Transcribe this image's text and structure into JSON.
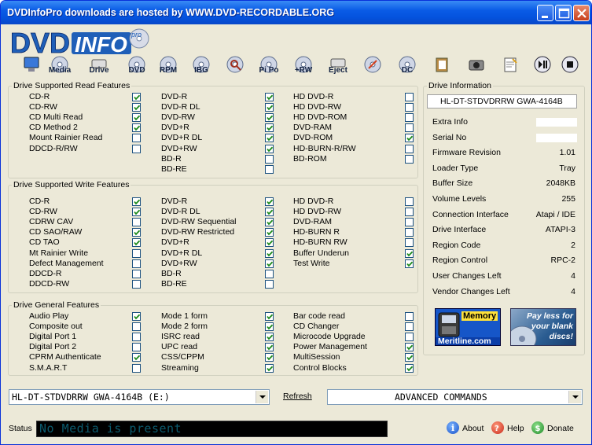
{
  "window": {
    "title": "DVDInfoPro downloads are hosted by WWW.DVD-RECORDABLE.ORG"
  },
  "logo": {
    "text_dvd": "DVD",
    "text_info": "INFO",
    "text_pro": "pro"
  },
  "toolbar": [
    {
      "name": "computer",
      "label": ""
    },
    {
      "name": "media",
      "label": "Media"
    },
    {
      "name": "drive",
      "label": "Drive"
    },
    {
      "name": "dvd",
      "label": "DVD"
    },
    {
      "name": "rpm",
      "label": "RPM"
    },
    {
      "name": "ibg",
      "label": "IBG"
    },
    {
      "name": "search",
      "label": ""
    },
    {
      "name": "pipo",
      "label": "Pi Po"
    },
    {
      "name": "plusrw",
      "label": "+RW"
    },
    {
      "name": "eject",
      "label": "Eject"
    },
    {
      "name": "burn",
      "label": ""
    },
    {
      "name": "dc",
      "label": "DC"
    },
    {
      "name": "clipboard",
      "label": ""
    },
    {
      "name": "camera",
      "label": ""
    },
    {
      "name": "notes",
      "label": ""
    },
    {
      "name": "play-pause",
      "label": ""
    },
    {
      "name": "stop",
      "label": ""
    }
  ],
  "read_features": {
    "title": "Drive Supported Read Features",
    "columns": [
      [
        {
          "label": "CD-R",
          "checked": true
        },
        {
          "label": "CD-RW",
          "checked": true
        },
        {
          "label": "CD Multi Read",
          "checked": true
        },
        {
          "label": "CD Method 2",
          "checked": true
        },
        {
          "label": "Mount Rainier Read",
          "checked": false
        },
        {
          "label": "DDCD-R/RW",
          "checked": false
        }
      ],
      [
        {
          "label": "DVD-R",
          "checked": true
        },
        {
          "label": "DVD-R DL",
          "checked": true
        },
        {
          "label": "DVD-RW",
          "checked": true
        },
        {
          "label": "DVD+R",
          "checked": true
        },
        {
          "label": "DVD+R DL",
          "checked": true
        },
        {
          "label": "DVD+RW",
          "checked": true
        },
        {
          "label": "BD-R",
          "checked": false
        },
        {
          "label": "BD-RE",
          "checked": false
        }
      ],
      [
        {
          "label": "HD DVD-R",
          "checked": false
        },
        {
          "label": "HD DVD-RW",
          "checked": false
        },
        {
          "label": "HD DVD-ROM",
          "checked": false
        },
        {
          "label": "DVD-RAM",
          "checked": false
        },
        {
          "label": "DVD-ROM",
          "checked": true
        },
        {
          "label": "HD-BURN-R/RW",
          "checked": false
        },
        {
          "label": "BD-ROM",
          "checked": false
        }
      ]
    ]
  },
  "write_features": {
    "title": "Drive Supported Write Features",
    "columns": [
      [
        {
          "label": "CD-R",
          "checked": true
        },
        {
          "label": "CD-RW",
          "checked": true
        },
        {
          "label": "CDRW CAV",
          "checked": false
        },
        {
          "label": "CD SAO/RAW",
          "checked": true
        },
        {
          "label": "CD TAO",
          "checked": true
        },
        {
          "label": "Mt Rainier Write",
          "checked": false
        },
        {
          "label": "Defect Management",
          "checked": false
        },
        {
          "label": "DDCD-R",
          "checked": false
        },
        {
          "label": "DDCD-RW",
          "checked": false
        }
      ],
      [
        {
          "label": "DVD-R",
          "checked": true
        },
        {
          "label": "DVD-R DL",
          "checked": true
        },
        {
          "label": "DVD-RW Sequential",
          "checked": true
        },
        {
          "label": "DVD-RW Restricted",
          "checked": true
        },
        {
          "label": "DVD+R",
          "checked": true
        },
        {
          "label": "DVD+R DL",
          "checked": true
        },
        {
          "label": "DVD+RW",
          "checked": true
        },
        {
          "label": "BD-R",
          "checked": false
        },
        {
          "label": "BD-RE",
          "checked": false
        }
      ],
      [
        {
          "label": "HD DVD-R",
          "checked": false
        },
        {
          "label": "HD DVD-RW",
          "checked": false
        },
        {
          "label": "DVD-RAM",
          "checked": false
        },
        {
          "label": "HD-BURN R",
          "checked": false
        },
        {
          "label": "HD-BURN RW",
          "checked": false
        },
        {
          "label": "Buffer Underun",
          "checked": true
        },
        {
          "label": "Test Write",
          "checked": true
        }
      ]
    ]
  },
  "general_features": {
    "title": "Drive General Features",
    "columns": [
      [
        {
          "label": "Audio Play",
          "checked": true
        },
        {
          "label": "Composite out",
          "checked": false
        },
        {
          "label": "Digital Port 1",
          "checked": false
        },
        {
          "label": "Digital Port 2",
          "checked": false
        },
        {
          "label": "CPRM Authenticate",
          "checked": true
        },
        {
          "label": "S.M.A.R.T",
          "checked": false
        }
      ],
      [
        {
          "label": "Mode 1 form",
          "checked": true
        },
        {
          "label": "Mode 2 form",
          "checked": true
        },
        {
          "label": "ISRC read",
          "checked": true
        },
        {
          "label": "UPC read",
          "checked": true
        },
        {
          "label": "CSS/CPPM",
          "checked": true
        },
        {
          "label": "Streaming",
          "checked": true
        }
      ],
      [
        {
          "label": "Bar code read",
          "checked": false
        },
        {
          "label": "CD Changer",
          "checked": false
        },
        {
          "label": "Microcode Upgrade",
          "checked": false
        },
        {
          "label": "Power Management",
          "checked": true
        },
        {
          "label": "MultiSession",
          "checked": true
        },
        {
          "label": "Control Blocks",
          "checked": true
        }
      ]
    ]
  },
  "drive_info": {
    "title": "Drive Information",
    "model": "HL-DT-STDVDRRW GWA-4164B",
    "fields": [
      {
        "label": "Extra Info",
        "value": ""
      },
      {
        "label": "Serial No",
        "value": ""
      },
      {
        "label": "Firmware Revision",
        "value": "1.01"
      },
      {
        "label": "Loader Type",
        "value": "Tray"
      },
      {
        "label": "Buffer Size",
        "value": "2048KB"
      },
      {
        "label": "Volume Levels",
        "value": "255"
      },
      {
        "label": "Connection Interface",
        "value": "Atapi / IDE"
      },
      {
        "label": "Drive Interface",
        "value": "ATAPI-3"
      },
      {
        "label": "Region Code",
        "value": "2"
      },
      {
        "label": "Region Control",
        "value": "RPC-2"
      },
      {
        "label": "User Changes Left",
        "value": "4"
      },
      {
        "label": "Vendor Changes Left",
        "value": "4"
      }
    ]
  },
  "ads": {
    "ad1_title": "Memory",
    "ad1_footer": "Meritline.com",
    "ad2_text": "Pay less for your blank discs!"
  },
  "bottom": {
    "drive_select": "HL-DT-STDVDRRW GWA-4164B (E:)",
    "refresh_label": "Refresh",
    "advanced_commands": "ADVANCED COMMANDS"
  },
  "status": {
    "label": "Status",
    "text": "No Media is present",
    "about": "About",
    "help": "Help",
    "donate": "Donate"
  },
  "colors": {
    "accent": "#0a5ce6",
    "check": "#1c8a1c",
    "status_text": "#0b5a6d"
  }
}
